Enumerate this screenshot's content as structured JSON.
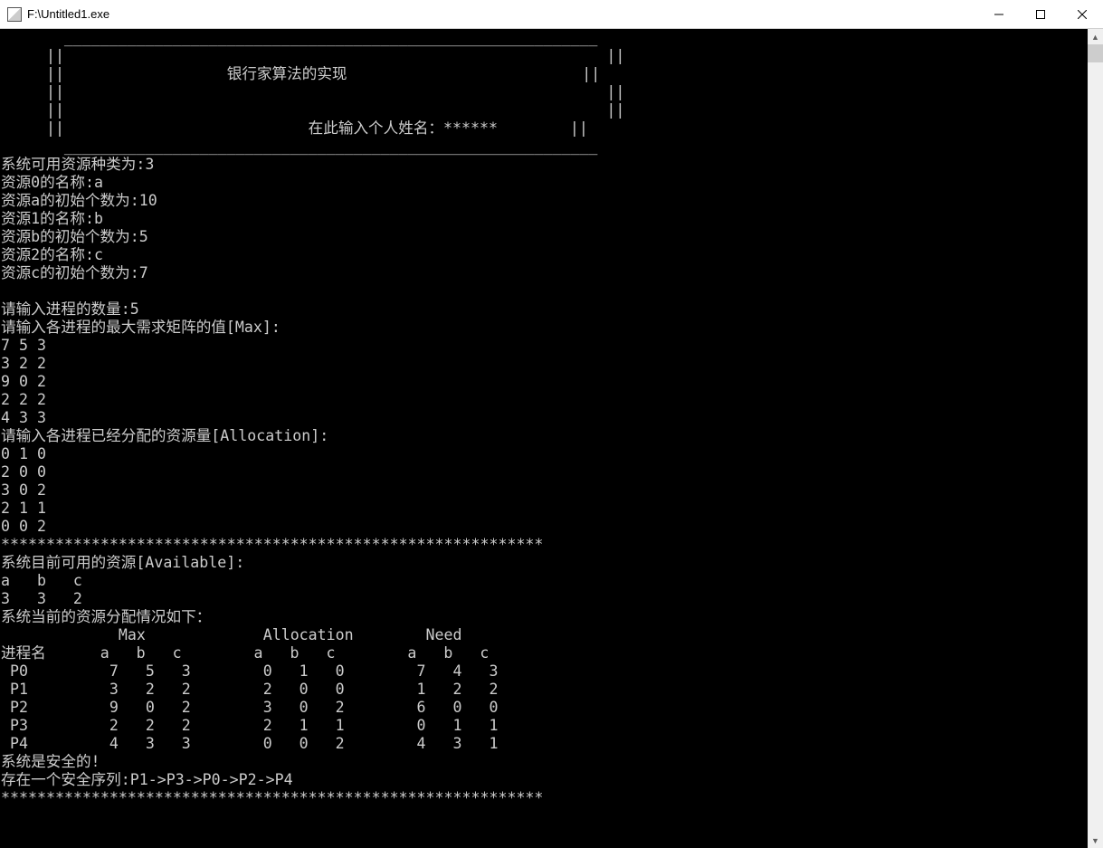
{
  "titlebar": {
    "path": "F:\\Untitled1.exe"
  },
  "banner": {
    "border_top": "       ___________________________________________________________",
    "side_open": "     ||                                                            ||",
    "title_line": "     ||                  银行家算法的实现                          ||",
    "author_line": "     ||                           在此输入个人姓名：******        ||",
    "border_bottom": "       ___________________________________________________________"
  },
  "resources": {
    "kinds_line": "系统可用资源种类为:3",
    "r0_name": "资源0的名称:a",
    "r0_init": "资源a的初始个数为:10",
    "r1_name": "资源1的名称:b",
    "r1_init": "资源b的初始个数为:5",
    "r2_name": "资源2的名称:c",
    "r2_init": "资源c的初始个数为:7"
  },
  "processes": {
    "count_line": "请输入进程的数量:5",
    "max_prompt": "请输入各进程的最大需求矩阵的值[Max]:",
    "max_rows": [
      "7 5 3",
      "3 2 2",
      "9 0 2",
      "2 2 2",
      "4 3 3"
    ],
    "alloc_prompt": "请输入各进程已经分配的资源量[Allocation]:",
    "alloc_rows": [
      "0 1 0",
      "2 0 0",
      "3 0 2",
      "2 1 1",
      "0 0 2"
    ]
  },
  "divider": "************************************************************",
  "available": {
    "title": "系统目前可用的资源[Available]:",
    "header": "a   b   c",
    "values": "3   3   2"
  },
  "table": {
    "title": "系统当前的资源分配情况如下：",
    "header1": "             Max             Allocation        Need",
    "header2": "进程名      a   b   c        a   b   c        a   b   c",
    "rows": [
      " P0         7   5   3        0   1   0        7   4   3",
      " P1         3   2   2        2   0   0        1   2   2",
      " P2         9   0   2        3   0   2        6   0   0",
      " P3         2   2   2        2   1   1        0   1   1",
      " P4         4   3   3        0   0   2        4   3   1"
    ]
  },
  "result": {
    "safe": "系统是安全的!",
    "sequence": "存在一个安全序列:P1->P3->P0->P2->P4"
  },
  "colors": {
    "bg": "#000000",
    "fg": "#cccccc",
    "titlebar_bg": "#ffffff"
  }
}
